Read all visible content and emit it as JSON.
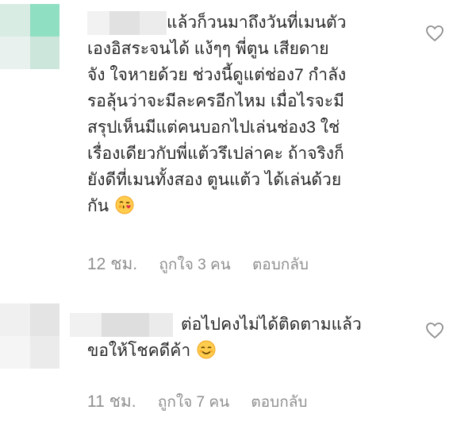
{
  "comments": [
    {
      "lines": [
        "แล้วก็วนมาถึงวันที่เมนตัว",
        "เองอิสระจนได้ แง้ๆๆ พี่ตูน เสียดาย",
        "จัง ใจหายด้วย ช่วงนี้ดูแต่ช่อง7 กำลัง",
        "รอลุ้นว่าจะมีละครอีกไหม เมื่อไรจะมี",
        "สรุปเห็นมีแต่คนบอกไปเล่นช่อง3 ใช่",
        "เรื่องเดียวกับพี่แต้วรึเปล่าคะ ถ้าจริงก็",
        "ยังดีที่เมนทั้งสอง ตูนแต้ว ได้เล่นด้วย",
        "กัน"
      ],
      "emoji_icon": "face-blowing-kiss-icon",
      "time": "12 ชม.",
      "likes": "ถูกใจ 3 คน",
      "reply": "ตอบกลับ"
    },
    {
      "lines": [
        "ต่อไปคงไม่ได้ติดตามแล้ว",
        "ขอให้โชคดีค้า"
      ],
      "emoji_icon": "smiling-blush-icon",
      "time": "11 ชม.",
      "likes": "ถูกใจ 7 คน",
      "reply": "ตอบกลับ"
    }
  ],
  "colors": {
    "text": "#262626",
    "meta": "#8e8e8e",
    "heart": "#8e8e8e",
    "avatar1": [
      "#d7ebe2",
      "#8edfc2",
      "#e6f0ec",
      "#cfe6dc"
    ],
    "avatar2": [
      "#efefef",
      "#e3e3e3",
      "#f4f4f4",
      "#ebebeb"
    ]
  }
}
